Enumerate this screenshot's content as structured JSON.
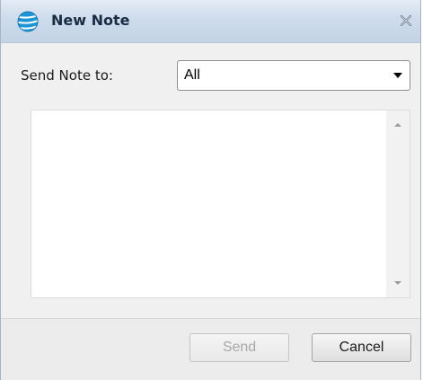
{
  "window": {
    "title": "New Note",
    "close_icon": "close-icon",
    "app_icon": "globe-logo-icon"
  },
  "form": {
    "send_to_label": "Send Note to:",
    "send_to_selected": "All",
    "note_text": ""
  },
  "buttons": {
    "send_label": "Send",
    "send_enabled": false,
    "cancel_label": "Cancel"
  },
  "colors": {
    "titlebar": "#cddbeb",
    "logo_blue": "#1d95d5",
    "disabled_text": "#a8a8a8"
  }
}
